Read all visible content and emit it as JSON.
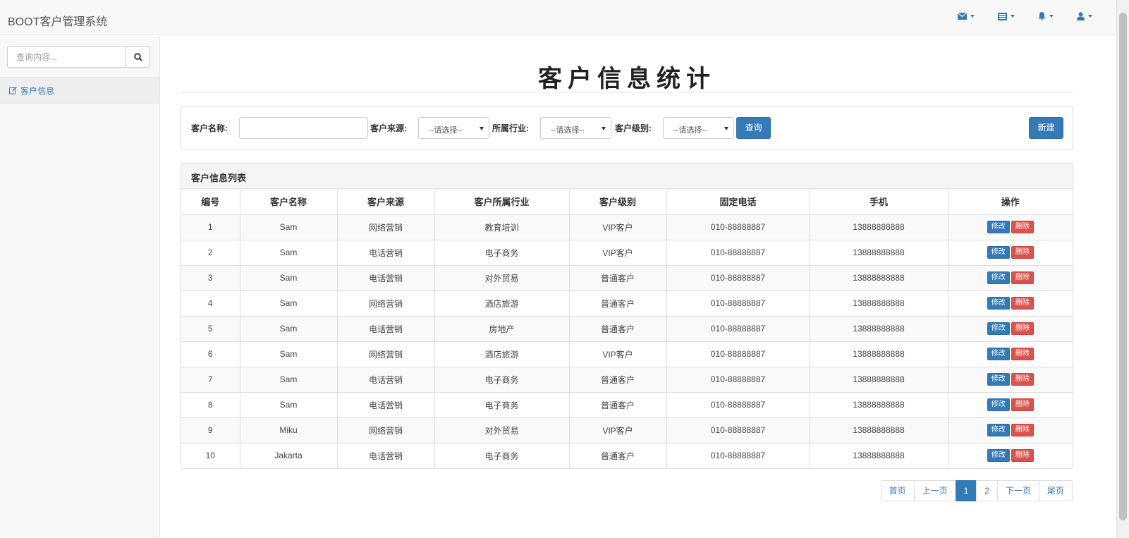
{
  "app": {
    "brand": "BOOT客户管理系统"
  },
  "navbar": {
    "icons": [
      "envelope-icon",
      "tasks-icon",
      "bell-icon",
      "user-icon"
    ]
  },
  "sidebar": {
    "search_placeholder": "查询内容...",
    "items": [
      {
        "label": "客户信息",
        "icon": "edit-icon"
      }
    ]
  },
  "page": {
    "title": "客户信息统计"
  },
  "filters": {
    "name_label": "客户名称:",
    "name_value": "",
    "source_label": "客户来源:",
    "source_selected": "--请选择--",
    "industry_label": "所属行业:",
    "industry_selected": "--请选择--",
    "level_label": "客户级别:",
    "level_selected": "--请选择--",
    "query_button": "查询",
    "new_button": "新建"
  },
  "list": {
    "heading": "客户信息列表",
    "columns": [
      "编号",
      "客户名称",
      "客户来源",
      "客户所属行业",
      "客户级别",
      "固定电话",
      "手机",
      "操作"
    ],
    "edit_label": "修改",
    "delete_label": "删除",
    "rows": [
      [
        "1",
        "Sam",
        "网络营销",
        "教育培训",
        "VIP客户",
        "010-88888887",
        "13888888888"
      ],
      [
        "2",
        "Sam",
        "电话营销",
        "电子商务",
        "VIP客户",
        "010-88888887",
        "13888888888"
      ],
      [
        "3",
        "Sam",
        "电话营销",
        "对外贸易",
        "普通客户",
        "010-88888887",
        "13888888888"
      ],
      [
        "4",
        "Sam",
        "网络营销",
        "酒店旅游",
        "普通客户",
        "010-88888887",
        "13888888888"
      ],
      [
        "5",
        "Sam",
        "电话营销",
        "房地产",
        "普通客户",
        "010-88888887",
        "13888888888"
      ],
      [
        "6",
        "Sam",
        "网络营销",
        "酒店旅游",
        "VIP客户",
        "010-88888887",
        "13888888888"
      ],
      [
        "7",
        "Sam",
        "电话营销",
        "电子商务",
        "普通客户",
        "010-88888887",
        "13888888888"
      ],
      [
        "8",
        "Sam",
        "电话营销",
        "电子商务",
        "普通客户",
        "010-88888887",
        "13888888888"
      ],
      [
        "9",
        "Miku",
        "网络营销",
        "对外贸易",
        "VIP客户",
        "010-88888887",
        "13888888888"
      ],
      [
        "10",
        "Jakarta",
        "电话营销",
        "电子商务",
        "普通客户",
        "010-88888887",
        "13888888888"
      ]
    ]
  },
  "pagination": {
    "first": "首页",
    "prev": "上一页",
    "pages": [
      "1",
      "2"
    ],
    "current": "1",
    "next": "下一页",
    "last": "尾页"
  },
  "colors": {
    "primary": "#337ab7",
    "danger": "#d9534f",
    "navbar_bg": "#f8f8f8"
  }
}
